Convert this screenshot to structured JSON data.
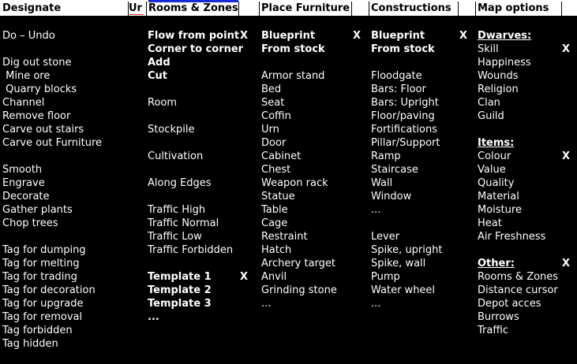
{
  "header": {
    "columns": [
      "Designate",
      "Ur",
      "Rooms & Zones",
      "",
      "Place Furniture",
      "",
      "Constructions",
      "",
      "Map options",
      ""
    ]
  },
  "designate": {
    "items": [
      {
        "label": "Do – Undo",
        "row": 0
      },
      {
        "label": "Dig out stone",
        "row": 2
      },
      {
        "label": " Mine ore",
        "row": 3
      },
      {
        "label": " Quarry blocks",
        "row": 4
      },
      {
        "label": "Channel",
        "row": 5
      },
      {
        "label": "Remove floor",
        "row": 6
      },
      {
        "label": "Carve out stairs",
        "row": 7
      },
      {
        "label": "Carve out Furniture",
        "row": 8
      },
      {
        "label": "Smooth",
        "row": 10
      },
      {
        "label": "Engrave",
        "row": 11
      },
      {
        "label": "Decorate",
        "row": 12
      },
      {
        "label": "Gather plants",
        "row": 13
      },
      {
        "label": "Chop trees",
        "row": 14
      },
      {
        "label": "Tag for dumping",
        "row": 16
      },
      {
        "label": "Tag for melting",
        "row": 17
      },
      {
        "label": "Tag for trading",
        "row": 18
      },
      {
        "label": "Tag for decoration",
        "row": 19
      },
      {
        "label": "Tag for upgrade",
        "row": 20
      },
      {
        "label": "Tag for removal",
        "row": 21
      },
      {
        "label": "Tag forbidden",
        "row": 22
      },
      {
        "label": "Tag hidden",
        "row": 23
      }
    ]
  },
  "rooms": {
    "items": [
      {
        "label": "Flow from point",
        "row": 0,
        "bold": true,
        "x": "X"
      },
      {
        "label": "Corner to corner",
        "row": 1,
        "bold": true
      },
      {
        "label": "Add",
        "row": 2,
        "bold": true
      },
      {
        "label": "Cut",
        "row": 3,
        "bold": true
      },
      {
        "label": "Room",
        "row": 5
      },
      {
        "label": "Stockpile",
        "row": 7
      },
      {
        "label": "Cultivation",
        "row": 9
      },
      {
        "label": "Along Edges",
        "row": 11
      },
      {
        "label": "Traffic High",
        "row": 13
      },
      {
        "label": "Traffic Normal",
        "row": 14
      },
      {
        "label": "Traffic Low",
        "row": 15
      },
      {
        "label": "Traffic Forbidden",
        "row": 16
      },
      {
        "label": "Template 1",
        "row": 18,
        "bold": true,
        "x": "X"
      },
      {
        "label": "Template 2",
        "row": 19,
        "bold": true
      },
      {
        "label": "Template 3",
        "row": 20,
        "bold": true
      },
      {
        "label": "...",
        "row": 21,
        "bold": true
      }
    ]
  },
  "furniture": {
    "items": [
      {
        "label": "Blueprint",
        "row": 0,
        "bold": true,
        "x": "X"
      },
      {
        "label": "From stock",
        "row": 1,
        "bold": true
      },
      {
        "label": "Armor stand",
        "row": 3
      },
      {
        "label": "Bed",
        "row": 4
      },
      {
        "label": "Seat",
        "row": 5
      },
      {
        "label": "Coffin",
        "row": 6
      },
      {
        "label": "Urn",
        "row": 7
      },
      {
        "label": "Door",
        "row": 8
      },
      {
        "label": "Cabinet",
        "row": 9
      },
      {
        "label": "Chest",
        "row": 10
      },
      {
        "label": "Weapon rack",
        "row": 11
      },
      {
        "label": "Statue",
        "row": 12
      },
      {
        "label": "Table",
        "row": 13
      },
      {
        "label": "Cage",
        "row": 14
      },
      {
        "label": "Restraint",
        "row": 15
      },
      {
        "label": "Hatch",
        "row": 16
      },
      {
        "label": "Archery target",
        "row": 17
      },
      {
        "label": "Anvil",
        "row": 18
      },
      {
        "label": "Grinding stone",
        "row": 19
      },
      {
        "label": "...",
        "row": 20
      }
    ]
  },
  "constructions": {
    "items": [
      {
        "label": "Blueprint",
        "row": 0,
        "bold": true,
        "x": "X"
      },
      {
        "label": "From stock",
        "row": 1,
        "bold": true
      },
      {
        "label": "Floodgate",
        "row": 3
      },
      {
        "label": "Bars: Floor",
        "row": 4
      },
      {
        "label": "Bars: Upright",
        "row": 5
      },
      {
        "label": "Floor/paving",
        "row": 6
      },
      {
        "label": "Fortifications",
        "row": 7
      },
      {
        "label": "Pillar/Support",
        "row": 8
      },
      {
        "label": "Ramp",
        "row": 9
      },
      {
        "label": "Staircase",
        "row": 10
      },
      {
        "label": "Wall",
        "row": 11
      },
      {
        "label": "Window",
        "row": 12
      },
      {
        "label": "...",
        "row": 13
      },
      {
        "label": "Lever",
        "row": 15
      },
      {
        "label": "Spike, upright",
        "row": 16
      },
      {
        "label": "Spike, wall",
        "row": 17
      },
      {
        "label": "Pump",
        "row": 18
      },
      {
        "label": "Water wheel",
        "row": 19
      },
      {
        "label": "...",
        "row": 20
      }
    ]
  },
  "map_options": {
    "items": [
      {
        "label": "Dwarves:",
        "row": 0,
        "section": true
      },
      {
        "label": "Skill",
        "row": 1,
        "x": "X"
      },
      {
        "label": "Happiness",
        "row": 2
      },
      {
        "label": "Wounds",
        "row": 3
      },
      {
        "label": "Religion",
        "row": 4
      },
      {
        "label": "Clan",
        "row": 5
      },
      {
        "label": "Guild",
        "row": 6
      },
      {
        "label": "Items:",
        "row": 8,
        "section": true
      },
      {
        "label": "Colour",
        "row": 9,
        "x": "X"
      },
      {
        "label": "Value",
        "row": 10
      },
      {
        "label": "Quality",
        "row": 11
      },
      {
        "label": "Material",
        "row": 12
      },
      {
        "label": "Moisture",
        "row": 13
      },
      {
        "label": "Heat",
        "row": 14
      },
      {
        "label": "Air Freshness",
        "row": 15
      },
      {
        "label": "Other:",
        "row": 17,
        "section": true,
        "x": "X"
      },
      {
        "label": "Rooms & Zones",
        "row": 18
      },
      {
        "label": "Distance cursor",
        "row": 19
      },
      {
        "label": "Depot acces",
        "row": 20
      },
      {
        "label": "Burrows",
        "row": 21
      },
      {
        "label": "Traffic",
        "row": 22
      }
    ]
  },
  "colors": {
    "background": "#000000",
    "header_bg": "#ffffff",
    "header_link": "#1a2bd6",
    "spell_underline": "#ff3333"
  }
}
